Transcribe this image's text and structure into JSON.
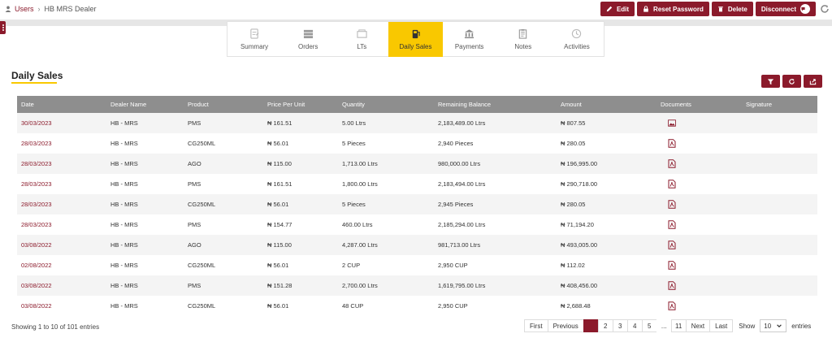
{
  "breadcrumb": {
    "parent": "Users",
    "current": "HB MRS Dealer"
  },
  "actions": {
    "edit": "Edit",
    "reset_password": "Reset Password",
    "delete": "Delete",
    "disconnect": "Disconnect"
  },
  "tabs": [
    {
      "label": "Summary",
      "icon": "summary-icon"
    },
    {
      "label": "Orders",
      "icon": "orders-icon"
    },
    {
      "label": "LTs",
      "icon": "lts-icon"
    },
    {
      "label": "Daily Sales",
      "icon": "fuel-pump-icon",
      "active": true
    },
    {
      "label": "Payments",
      "icon": "bank-icon"
    },
    {
      "label": "Notes",
      "icon": "notes-icon"
    },
    {
      "label": "Activities",
      "icon": "activities-icon"
    }
  ],
  "page_title": "Daily Sales",
  "table": {
    "headers": [
      "Date",
      "Dealer Name",
      "Product",
      "Price Per Unit",
      "Quantity",
      "Remaining Balance",
      "Amount",
      "Documents",
      "Signature"
    ],
    "rows": [
      {
        "date": "30/03/2023",
        "dealer": "HB - MRS",
        "product": "PMS",
        "price": "₦ 161.51",
        "quantity": "5.00 Ltrs",
        "balance": "2,183,489.00 Ltrs",
        "amount": "₦ 807.55",
        "doc": "image"
      },
      {
        "date": "28/03/2023",
        "dealer": "HB - MRS",
        "product": "CG250ML",
        "price": "₦ 56.01",
        "quantity": "5 Pieces",
        "balance": "2,940 Pieces",
        "amount": "₦ 280.05",
        "doc": "pdf"
      },
      {
        "date": "28/03/2023",
        "dealer": "HB - MRS",
        "product": "AGO",
        "price": "₦ 115.00",
        "quantity": "1,713.00 Ltrs",
        "balance": "980,000.00 Ltrs",
        "amount": "₦ 196,995.00",
        "doc": "pdf"
      },
      {
        "date": "28/03/2023",
        "dealer": "HB - MRS",
        "product": "PMS",
        "price": "₦ 161.51",
        "quantity": "1,800.00 Ltrs",
        "balance": "2,183,494.00 Ltrs",
        "amount": "₦ 290,718.00",
        "doc": "pdf"
      },
      {
        "date": "28/03/2023",
        "dealer": "HB - MRS",
        "product": "CG250ML",
        "price": "₦ 56.01",
        "quantity": "5 Pieces",
        "balance": "2,945 Pieces",
        "amount": "₦ 280.05",
        "doc": "pdf"
      },
      {
        "date": "28/03/2023",
        "dealer": "HB - MRS",
        "product": "PMS",
        "price": "₦ 154.77",
        "quantity": "460.00 Ltrs",
        "balance": "2,185,294.00 Ltrs",
        "amount": "₦ 71,194.20",
        "doc": "pdf"
      },
      {
        "date": "03/08/2022",
        "dealer": "HB - MRS",
        "product": "AGO",
        "price": "₦ 115.00",
        "quantity": "4,287.00 Ltrs",
        "balance": "981,713.00 Ltrs",
        "amount": "₦ 493,005.00",
        "doc": "pdf"
      },
      {
        "date": "02/08/2022",
        "dealer": "HB - MRS",
        "product": "CG250ML",
        "price": "₦ 56.01",
        "quantity": "2 CUP",
        "balance": "2,950 CUP",
        "amount": "₦ 112.02",
        "doc": "pdf"
      },
      {
        "date": "03/08/2022",
        "dealer": "HB - MRS",
        "product": "PMS",
        "price": "₦ 151.28",
        "quantity": "2,700.00 Ltrs",
        "balance": "1,619,795.00 Ltrs",
        "amount": "₦ 408,456.00",
        "doc": "pdf"
      },
      {
        "date": "03/08/2022",
        "dealer": "HB - MRS",
        "product": "CG250ML",
        "price": "₦ 56.01",
        "quantity": "48 CUP",
        "balance": "2,950 CUP",
        "amount": "₦ 2,688.48",
        "doc": "pdf"
      }
    ]
  },
  "footer": {
    "showing": "Showing 1 to 10 of 101 entries",
    "first": "First",
    "previous": "Previous",
    "pages": [
      "2",
      "3",
      "4",
      "5"
    ],
    "dots": "...",
    "last_page": "11",
    "next": "Next",
    "last": "Last",
    "show_label": "Show",
    "page_size": "10",
    "entries_label": "entries"
  },
  "colors": {
    "brand": "#8b1a2b",
    "accent": "#f9c800",
    "header": "#8e8e8e"
  }
}
